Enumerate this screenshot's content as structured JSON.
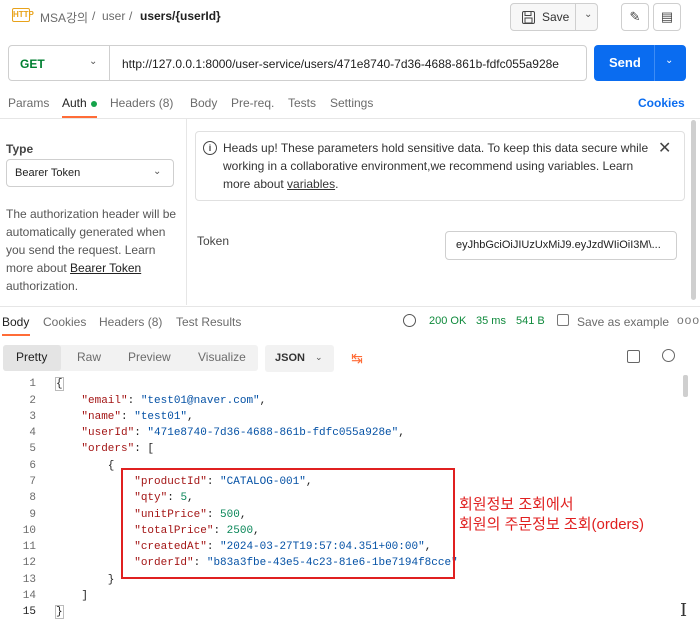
{
  "breadcrumb": {
    "collection": "MSA강의",
    "folder": "user",
    "request": "users/{userId}",
    "sep": "/",
    "http_badge": "HTTP"
  },
  "toolbar": {
    "save_label": "Save"
  },
  "request": {
    "method": "GET",
    "url": "http://127.0.0.1:8000/user-service/users/471e8740-7d36-4688-861b-fdfc055a928e",
    "send_label": "Send"
  },
  "request_tabs": {
    "params": "Params",
    "auth": "Auth",
    "headers": "Headers (8)",
    "body": "Body",
    "prereq": "Pre-req.",
    "tests": "Tests",
    "settings": "Settings",
    "cookies": "Cookies"
  },
  "auth": {
    "type_label": "Type",
    "type_value": "Bearer Token",
    "desc_before": "The authorization header will be automatically generated when you send the request. Learn more about ",
    "desc_link": "Bearer Token",
    "desc_after": " authorization.",
    "notice_text": "Heads up! These parameters hold sensitive data. To keep this data secure while working in a collaborative environment,we recommend using variables. Learn more about ",
    "notice_link": "variables",
    "notice_end": ".",
    "token_label": "Token",
    "token_value": "eyJhbGciOiJIUzUxMiJ9.eyJzdWIiOiI3M\\..."
  },
  "response_tabs": {
    "body": "Body",
    "cookies": "Cookies",
    "headers": "Headers (8)",
    "tests": "Test Results"
  },
  "response_meta": {
    "status": "200 OK",
    "time": "35 ms",
    "size": "541 B",
    "save_example": "Save as example",
    "more": "ooo"
  },
  "view_tabs": {
    "pretty": "Pretty",
    "raw": "Raw",
    "preview": "Preview",
    "visualize": "Visualize",
    "format": "JSON"
  },
  "code": {
    "line_numbers": [
      "1",
      "2",
      "3",
      "4",
      "5",
      "6",
      "7",
      "8",
      "9",
      "10",
      "11",
      "12",
      "13",
      "14",
      "15"
    ],
    "email_key": "\"email\"",
    "email_val": "\"test01@naver.com\"",
    "name_key": "\"name\"",
    "name_val": "\"test01\"",
    "userId_key": "\"userId\"",
    "userId_val": "\"471e8740-7d36-4688-861b-fdfc055a928e\"",
    "orders_key": "\"orders\"",
    "productId_key": "\"productId\"",
    "productId_val": "\"CATALOG-001\"",
    "qty_key": "\"qty\"",
    "qty_val": "5",
    "unitPrice_key": "\"unitPrice\"",
    "unitPrice_val": "500",
    "totalPrice_key": "\"totalPrice\"",
    "totalPrice_val": "2500",
    "createdAt_key": "\"createdAt\"",
    "createdAt_val": "\"2024-03-27T19:57:04.351+00:00\"",
    "orderId_key": "\"orderId\"",
    "orderId_val": "\"b83a3fbe-43e5-4c23-81e6-1be7194f8cce\""
  },
  "annotation": {
    "line1": "회원정보 조회에서",
    "line2": "회원의 주문정보 조회(orders)",
    "color": "#e02020"
  },
  "colors": {
    "accent": "#ff6c37",
    "send": "#0a6cf0",
    "get": "#007f31",
    "ok": "#0f8a3c"
  }
}
